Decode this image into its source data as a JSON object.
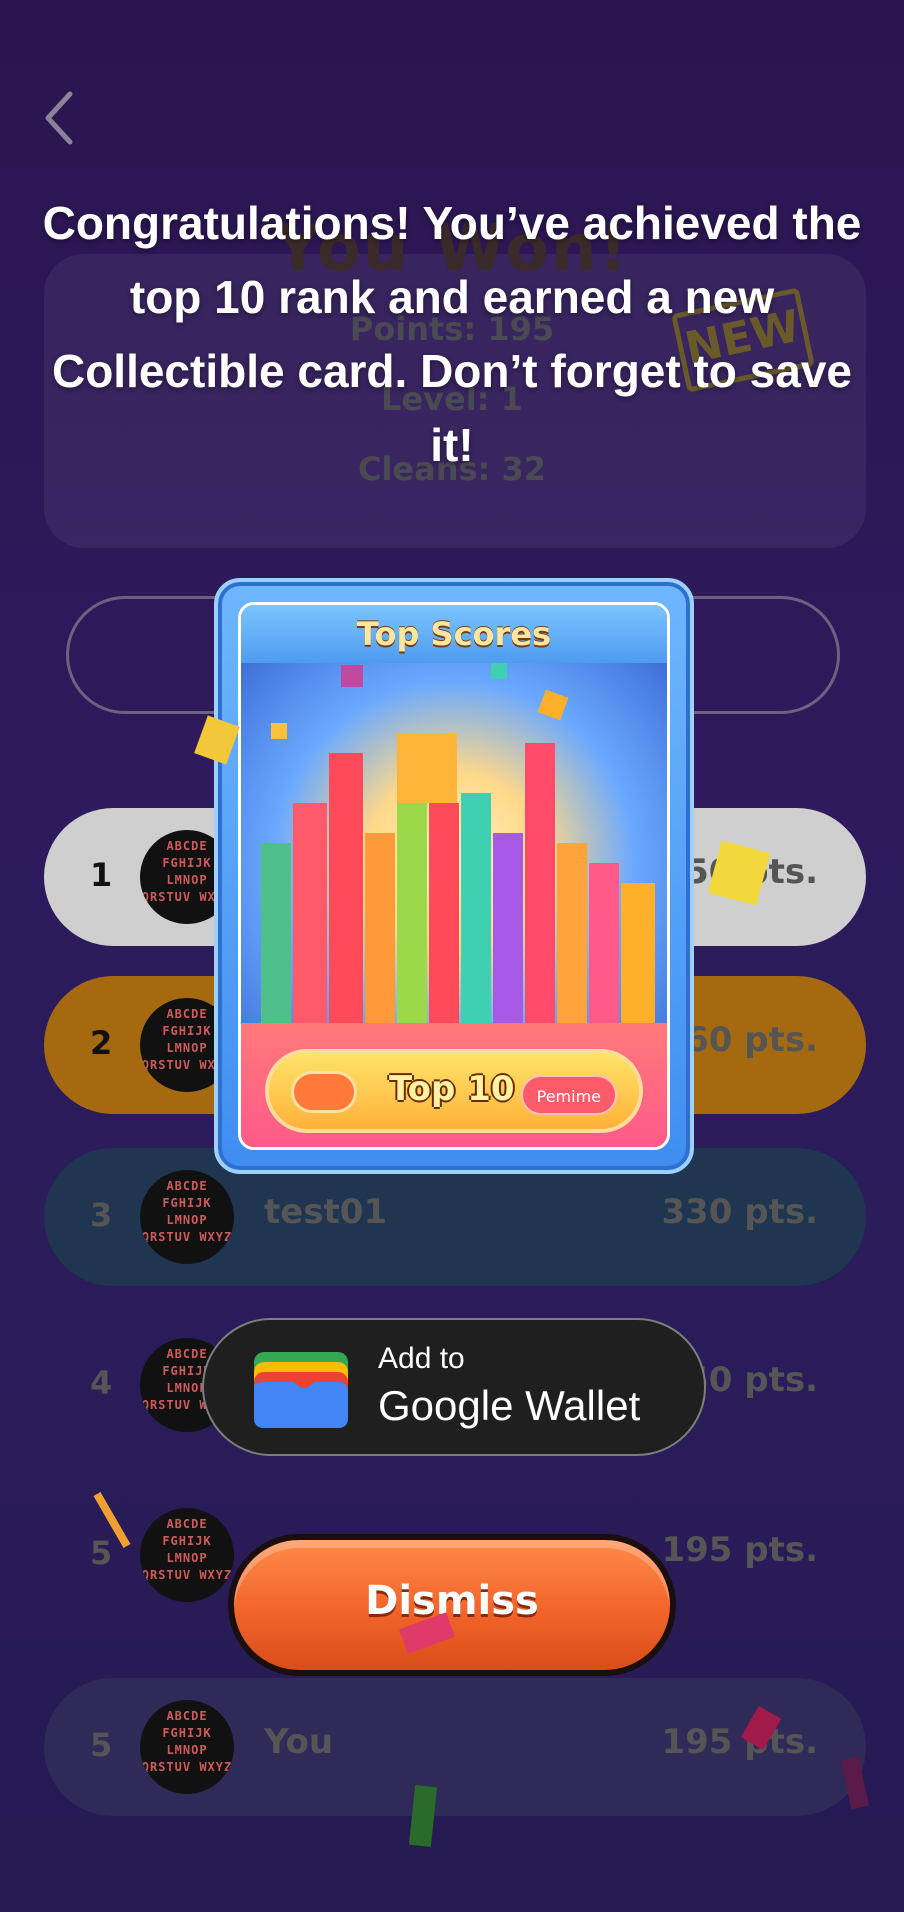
{
  "background": {
    "result_title": "You Won!",
    "stats": {
      "points": "Points: 195",
      "level": "Level: 1",
      "cleans": "Cleans: 32"
    },
    "new_badge": "NEW",
    "leaderboard": [
      {
        "rank": "1",
        "name": "",
        "points": "450 pts.",
        "color": "#cfcfcf"
      },
      {
        "rank": "2",
        "name": "",
        "points": "360 pts.",
        "color": "#a56a10"
      },
      {
        "rank": "3",
        "name": "test01",
        "points": "330 pts.",
        "color": "#1f3550"
      },
      {
        "rank": "4",
        "name": "",
        "points": "250 pts.",
        "color": "#2a2050"
      },
      {
        "rank": "5",
        "name": "",
        "points": "195 pts.",
        "color": "#2a2050"
      },
      {
        "rank": "5",
        "name": "You",
        "points": "195 pts.",
        "color": "#2f2a58"
      }
    ],
    "avatar_letters": "ABCDE FGHIJK LMNOP QRSTUV WXYZ"
  },
  "modal": {
    "headline": "Congratulations! You’ve achieved the top 10 rank and earned a new Collectible card. Don’t forget to save it!",
    "card": {
      "title": "Top Scores",
      "pill_label": "Top 10",
      "pill_tag": "Pemime"
    },
    "wallet": {
      "line1": "Add to",
      "line2": "Google Wallet"
    },
    "dismiss_label": "Dismiss"
  }
}
